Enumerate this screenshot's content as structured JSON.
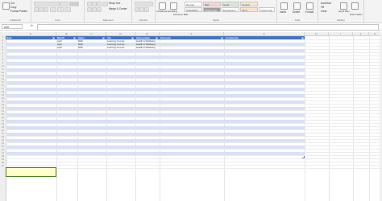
{
  "ribbon": {
    "clipboard": {
      "label": "Clipboard",
      "cut": "Cut",
      "copy": "Copy",
      "paste": "Paste",
      "format_painter": "Format Painter"
    },
    "font": {
      "label": "Font"
    },
    "alignment": {
      "label": "Alignment",
      "wrap_text": "Wrap Text",
      "merge_center": "Merge & Center"
    },
    "number": {
      "label": "Number"
    },
    "styles": {
      "label": "Styles",
      "cells": [
        "Normal",
        "Bad",
        "Good",
        "Neutral",
        "Calculation",
        "Check Cell",
        "Explanatory",
        "Input",
        "Linked Cell"
      ],
      "conditional_formatting": "Conditional Formatting",
      "format_as_table": "Format as Table"
    },
    "cells": {
      "label": "Cells",
      "insert": "Insert",
      "delete": "Delete",
      "format": "Format"
    },
    "editing": {
      "label": "Editing",
      "autosum": "AutoSum",
      "fill": "Fill",
      "clear": "Clear",
      "sort_filter": "Sort & Filter",
      "find_select": "Find & Select"
    }
  },
  "formula_bar": {
    "name_box": "A36",
    "fx": "fx",
    "value": ""
  },
  "columns": [
    "A",
    "B",
    "C",
    "D",
    "E",
    "F",
    "G",
    "H",
    "I",
    "J",
    "K"
  ],
  "table": {
    "headers": [
      "Date",
      "Month",
      "Class",
      "Via",
      "Intervention",
      "Outcome",
      "Comments"
    ],
    "rows": [
      [
        "",
        "April",
        "MHF",
        "Learning On-Line",
        "Health & Wellbeing",
        "",
        ""
      ],
      [
        "",
        "April",
        "MHF",
        "Learning On-Line",
        "Health & Wellbeing",
        "",
        ""
      ],
      [
        "",
        "April",
        "MHF",
        "Learning On-Line",
        "Health & Wellbeing",
        "",
        ""
      ]
    ],
    "total_rows": 41,
    "colors": {
      "header": "#4472c4",
      "band": "#d9e1f2"
    }
  },
  "selection": {
    "cell": "A36",
    "fill": "#ffffc9"
  },
  "row_numbers": [
    "1",
    "2",
    "3",
    "4",
    "5",
    "6",
    "7",
    "8",
    "9",
    "10",
    "11",
    "12",
    "13",
    "14",
    "15",
    "16",
    "17",
    "18",
    "19",
    "20",
    "21",
    "22",
    "23",
    "24",
    "25",
    "26",
    "27",
    "28",
    "29",
    "30",
    "31",
    "32",
    "33",
    "34",
    "35",
    "36",
    "37",
    "38",
    "39",
    "40",
    "41"
  ]
}
